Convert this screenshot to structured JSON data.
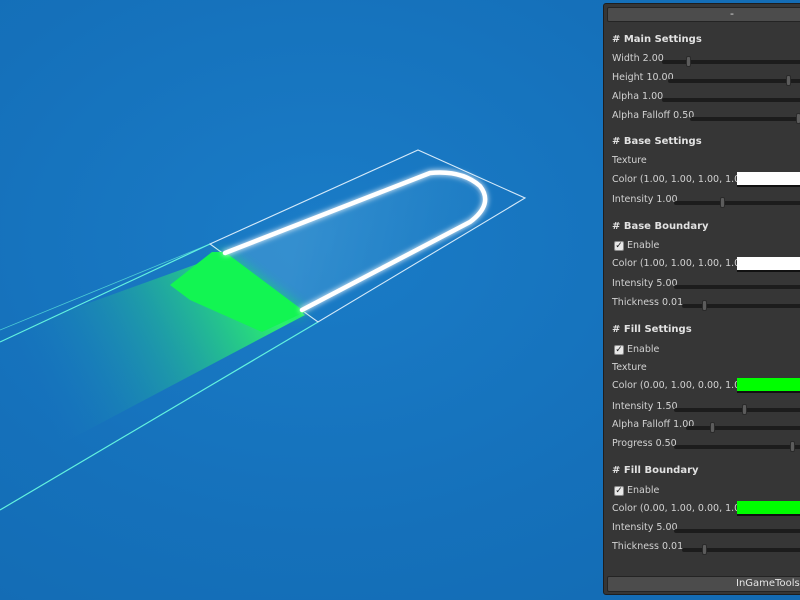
{
  "panel": {
    "collapse_label": "-",
    "footer_label": "InGameTools"
  },
  "sections": {
    "main": {
      "header": "# Main Settings",
      "width_label": "Width",
      "width_value": "2.00",
      "height_label": "Height",
      "height_value": "10.00",
      "alpha_label": "Alpha",
      "alpha_value": "1.00",
      "alpha_falloff_label": "Alpha Falloff",
      "alpha_falloff_value": "0.50"
    },
    "base": {
      "header": "# Base Settings",
      "texture_label": "Texture",
      "color_label": "Color (1.00, 1.00, 1.00, 1.00)",
      "color_hex": "#ffffff",
      "intensity_label": "Intensity",
      "intensity_value": "1.00"
    },
    "base_boundary": {
      "header": "# Base Boundary",
      "enable_label": "Enable",
      "enabled": true,
      "color_label": "Color (1.00, 1.00, 1.00, 1.00)",
      "color_hex": "#ffffff",
      "intensity_label": "Intensity",
      "intensity_value": "5.00",
      "thickness_label": "Thickness",
      "thickness_value": "0.01"
    },
    "fill": {
      "header": "# Fill Settings",
      "enable_label": "Enable",
      "enabled": true,
      "texture_label": "Texture",
      "color_label": "Color (0.00, 1.00, 0.00, 1.00)",
      "color_hex": "#00ff00",
      "intensity_label": "Intensity",
      "intensity_value": "1.50",
      "alpha_falloff_label": "Alpha Falloff",
      "alpha_falloff_value": "1.00",
      "progress_label": "Progress",
      "progress_value": "0.50"
    },
    "fill_boundary": {
      "header": "# Fill Boundary",
      "enable_label": "Enable",
      "enabled": true,
      "color_label": "Color (0.00, 1.00, 0.00, 1.00)",
      "color_hex": "#00ff00",
      "intensity_label": "Intensity",
      "intensity_value": "5.00",
      "thickness_label": "Thickness",
      "thickness_value": "0.01"
    }
  },
  "colors": {
    "background": "#1673bd",
    "panel": "#363636",
    "fill_green": "#00ff44",
    "boundary_cyan": "#5ff0e0",
    "bar_outline": "#ffffff"
  }
}
